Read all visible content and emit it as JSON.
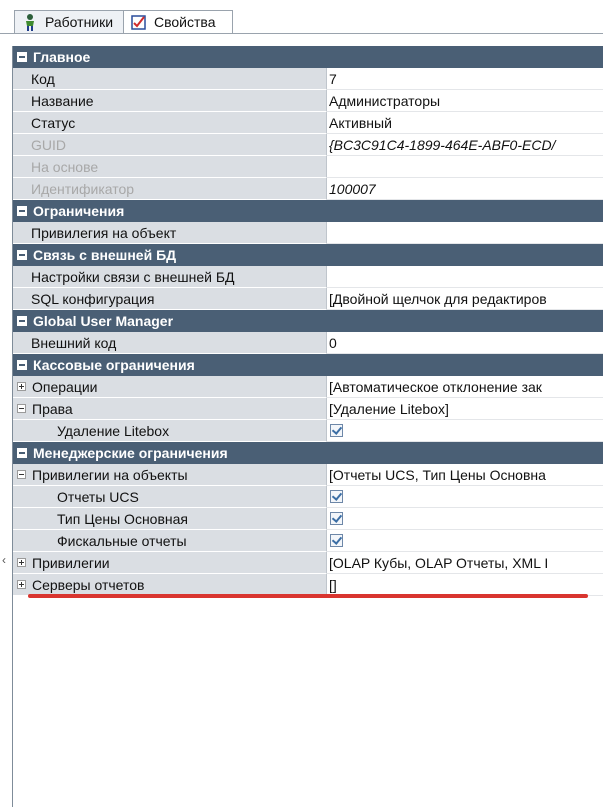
{
  "tabs": [
    {
      "label": "Работники",
      "icon": "person-icon",
      "active": false
    },
    {
      "label": "Свойства",
      "icon": "properties-icon",
      "active": true
    }
  ],
  "grid": {
    "sections": [
      {
        "title": "Главное",
        "rows": [
          {
            "name": "Код",
            "value": "7"
          },
          {
            "name": "Название",
            "value": "Администраторы"
          },
          {
            "name": "Статус",
            "value": "Активный"
          },
          {
            "name": "GUID",
            "value": "{BC3C91C4-1899-464E-ABF0-ECD/",
            "disabled": true,
            "italic": true
          },
          {
            "name": "На основе",
            "value": "",
            "disabled": true
          },
          {
            "name": "Идентификатор",
            "value": "100007",
            "disabled": true,
            "italic": true
          }
        ]
      },
      {
        "title": "Ограничения",
        "rows": [
          {
            "name": "Привилегия на объект",
            "value": ""
          }
        ]
      },
      {
        "title": "Связь с внешней БД",
        "rows": [
          {
            "name": "Настройки связи с внешней БД",
            "value": ""
          },
          {
            "name": "SQL конфигурация",
            "value": "[Двойной щелчок для редактиров"
          }
        ]
      },
      {
        "title": "Global User Manager",
        "rows": [
          {
            "name": "Внешний код",
            "value": "0"
          }
        ]
      },
      {
        "title": "Кассовые ограничения",
        "rows": [
          {
            "name": "Операции",
            "value": "[Автоматическое отклонение зак",
            "expander": "plus"
          },
          {
            "name": "Права",
            "value": "[Удаление Litebox]",
            "expander": "minus"
          },
          {
            "name": "Удаление Litebox",
            "checked": true,
            "child": true
          }
        ]
      },
      {
        "title": "Менеджерские ограничения",
        "rows": [
          {
            "name": "Привилегии на объекты",
            "value": "[Отчеты UCS, Тип Цены Основна",
            "expander": "minus"
          },
          {
            "name": "Отчеты UCS",
            "checked": true,
            "child": true
          },
          {
            "name": "Тип Цены Основная",
            "checked": true,
            "child": true
          },
          {
            "name": "Фискальные отчеты",
            "checked": true,
            "child": true
          },
          {
            "name": "Привилегии",
            "value": "[OLAP Кубы, OLAP Отчеты, XML I",
            "expander": "plus"
          },
          {
            "name": "Серверы отчетов",
            "value": "[]",
            "expander": "plus"
          }
        ]
      }
    ]
  },
  "colors": {
    "category_header": "#4a5f75",
    "name_column": "#dadee3",
    "highlight_line": "#d9352f"
  }
}
